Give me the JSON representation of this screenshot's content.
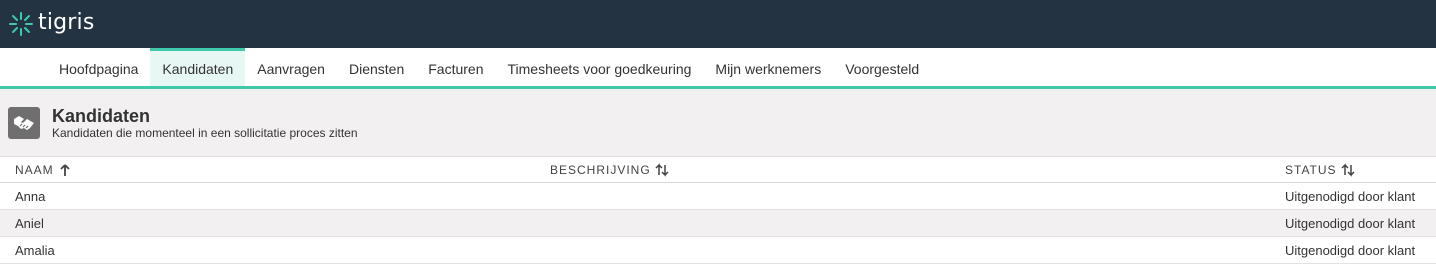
{
  "app": {
    "logo_text": "tigris"
  },
  "nav": {
    "items": [
      {
        "label": "Hoofdpagina"
      },
      {
        "label": "Kandidaten"
      },
      {
        "label": "Aanvragen"
      },
      {
        "label": "Diensten"
      },
      {
        "label": "Facturen"
      },
      {
        "label": "Timesheets voor goedkeuring"
      },
      {
        "label": "Mijn werknemers"
      },
      {
        "label": "Voorgesteld"
      }
    ],
    "active_index": 1
  },
  "page": {
    "title": "Kandidaten",
    "subtitle": "Kandidaten die momenteel in een sollicitatie proces zitten",
    "icon": "handshake-icon"
  },
  "table": {
    "columns": [
      {
        "label": "NAAM",
        "sort": "ascending"
      },
      {
        "label": "BESCHRIJVING",
        "sort": "none"
      },
      {
        "label": "STATUS",
        "sort": "none"
      }
    ],
    "rows": [
      {
        "name": "Anna",
        "description": "",
        "status": "Uitgenodigd door klant"
      },
      {
        "name": "Aniel",
        "description": "",
        "status": "Uitgenodigd door klant"
      },
      {
        "name": "Amalia",
        "description": "",
        "status": "Uitgenodigd door klant"
      }
    ]
  },
  "colors": {
    "topbar": "#243342",
    "accent": "#3ec9aa",
    "header_bg": "#f2f0f0"
  }
}
